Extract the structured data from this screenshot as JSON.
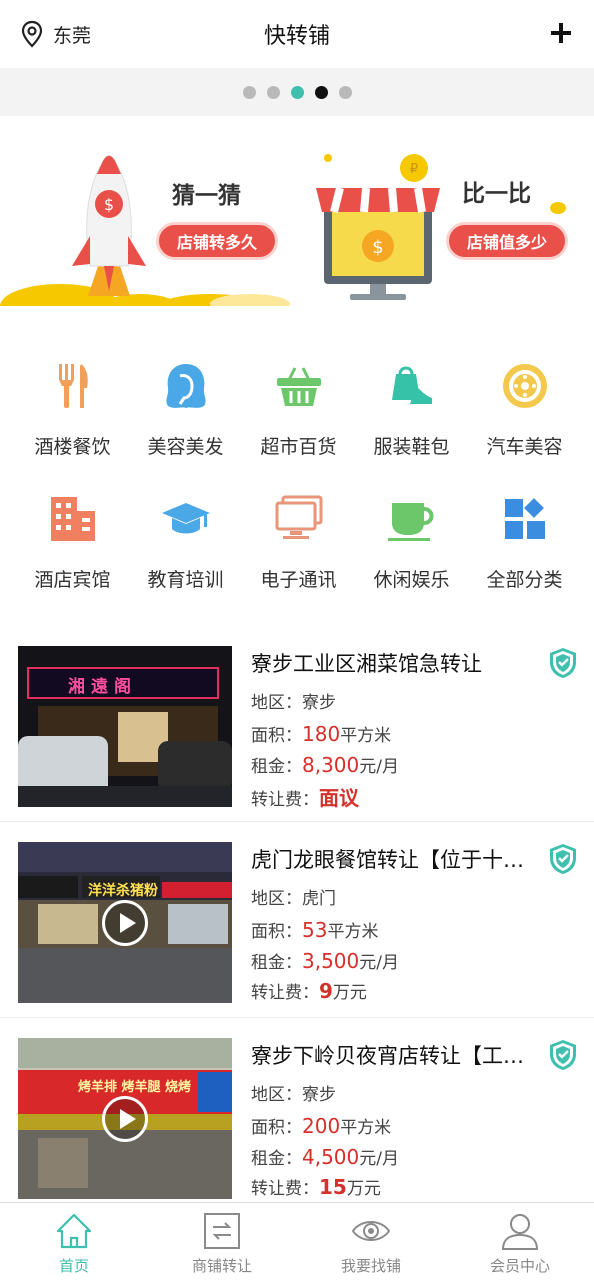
{
  "header": {
    "location": "东莞",
    "title": "快转铺",
    "add_icon": "plus-icon",
    "location_icon": "location-pin-icon"
  },
  "pager": {
    "count": 5,
    "active_index": 3,
    "highlight_index": 2
  },
  "banner": {
    "left": {
      "title": "猜一猜",
      "button": "店铺转多久"
    },
    "right": {
      "title": "比一比",
      "button": "店铺值多少"
    }
  },
  "categories": [
    {
      "label": "酒楼餐饮",
      "icon": "fork-knife-icon",
      "color": "#f0a05a"
    },
    {
      "label": "美容美发",
      "icon": "hair-beauty-icon",
      "color": "#4aa8e6"
    },
    {
      "label": "超市百货",
      "icon": "basket-icon",
      "color": "#6cc76b"
    },
    {
      "label": "服装鞋包",
      "icon": "bag-heels-icon",
      "color": "#36c2a9"
    },
    {
      "label": "汽车美容",
      "icon": "wheel-icon",
      "color": "#f2c94c"
    },
    {
      "label": "酒店宾馆",
      "icon": "building-icon",
      "color": "#f08060"
    },
    {
      "label": "教育培训",
      "icon": "graduation-cap-icon",
      "color": "#4aa8e6"
    },
    {
      "label": "电子通讯",
      "icon": "monitor-icon",
      "color": "#e8957a"
    },
    {
      "label": "休闲娱乐",
      "icon": "cup-icon",
      "color": "#6cc76b"
    },
    {
      "label": "全部分类",
      "icon": "grid-icon",
      "color": "#3b8de0"
    }
  ],
  "listings": [
    {
      "title": "寮步工业区湘菜馆急转让",
      "region_label": "地区：",
      "region": "寮步",
      "area_label": "面积：",
      "area": "180",
      "area_unit": "平方米",
      "rent_label": "租金：",
      "rent": "8,300",
      "rent_unit": "元/月",
      "fee_label": "转让费：",
      "fee": "面议",
      "fee_unit": "",
      "sign_text": "湘遠阁",
      "has_video": false
    },
    {
      "title": "虎门龙眼餐馆转让【位于十…",
      "region_label": "地区：",
      "region": "虎门",
      "area_label": "面积：",
      "area": "53",
      "area_unit": "平方米",
      "rent_label": "租金：",
      "rent": "3,500",
      "rent_unit": "元/月",
      "fee_label": "转让费：",
      "fee": "9",
      "fee_unit": "万元",
      "sign_text": "洋洋杀猪粉",
      "has_video": true
    },
    {
      "title": "寮步下岭贝夜宵店转让【工…",
      "region_label": "地区：",
      "region": "寮步",
      "area_label": "面积：",
      "area": "200",
      "area_unit": "平方米",
      "rent_label": "租金：",
      "rent": "4,500",
      "rent_unit": "元/月",
      "fee_label": "转让费：",
      "fee": "15",
      "fee_unit": "万元",
      "sign_text": "烤羊排 烤羊腿 烧烤",
      "has_video": true
    }
  ],
  "tabbar": [
    {
      "label": "首页",
      "icon": "home-icon",
      "active": true
    },
    {
      "label": "商铺转让",
      "icon": "transfer-icon",
      "active": false
    },
    {
      "label": "我要找铺",
      "icon": "eye-icon",
      "active": false
    },
    {
      "label": "会员中心",
      "icon": "user-icon",
      "active": false
    }
  ],
  "colors": {
    "accent": "#3fbfae",
    "price": "#d6302a",
    "banner_button": "#e9504a"
  }
}
